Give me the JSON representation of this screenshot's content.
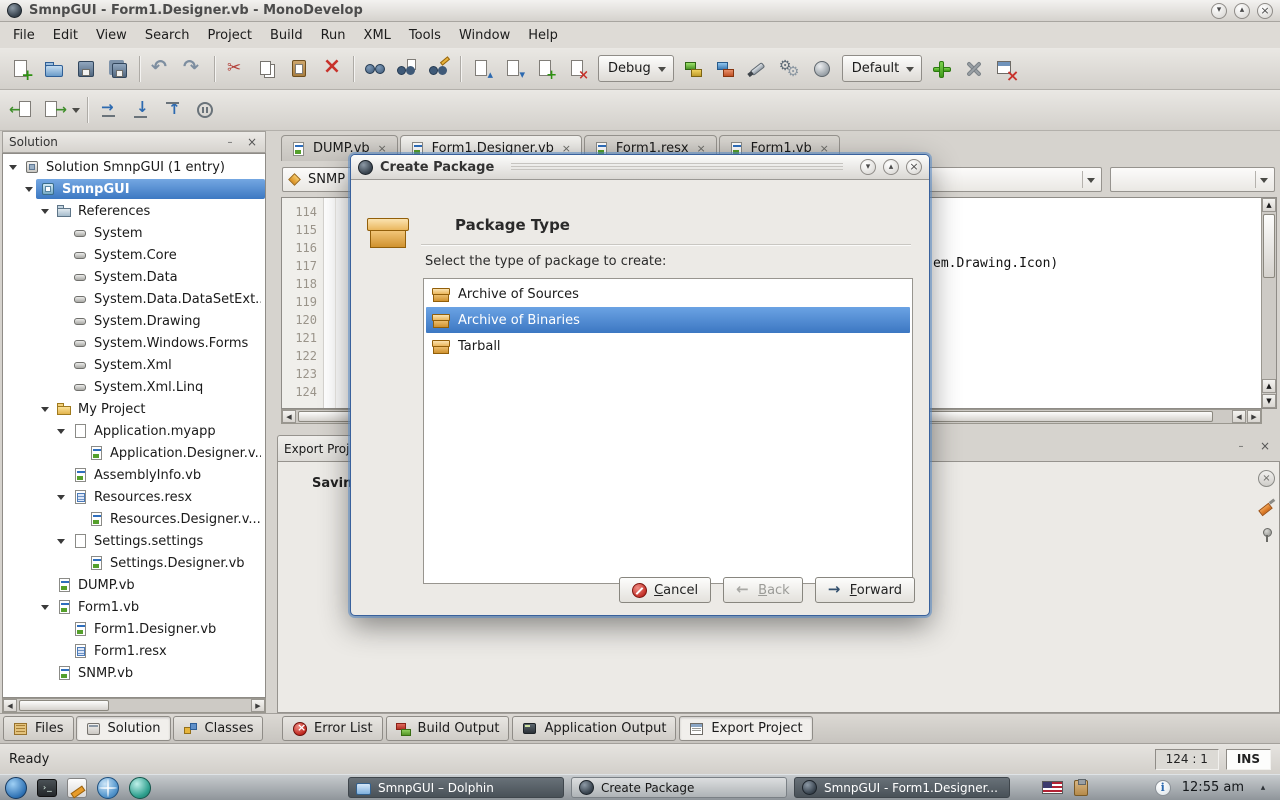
{
  "titlebar": {
    "title": "SmnpGUI - Form1.Designer.vb - MonoDevelop"
  },
  "menubar": {
    "items": [
      "File",
      "Edit",
      "View",
      "Search",
      "Project",
      "Build",
      "Run",
      "XML",
      "Tools",
      "Window",
      "Help"
    ]
  },
  "toolbar": {
    "debug_combo": "Debug",
    "default_combo": "Default"
  },
  "solution_panel": {
    "header": "Solution",
    "tree": [
      {
        "label": "Solution SmnpGUI (1 entry)",
        "level": 0,
        "icon": "solution",
        "expander": true
      },
      {
        "label": "SmnpGUI",
        "level": 1,
        "icon": "project",
        "expander": true,
        "selected": true
      },
      {
        "label": "References",
        "level": 2,
        "icon": "references-folder",
        "expander": true
      },
      {
        "label": "System",
        "level": 3,
        "icon": "reference"
      },
      {
        "label": "System.Core",
        "level": 3,
        "icon": "reference"
      },
      {
        "label": "System.Data",
        "level": 3,
        "icon": "reference"
      },
      {
        "label": "System.Data.DataSetExt...",
        "level": 3,
        "icon": "reference"
      },
      {
        "label": "System.Drawing",
        "level": 3,
        "icon": "reference"
      },
      {
        "label": "System.Windows.Forms",
        "level": 3,
        "icon": "reference"
      },
      {
        "label": "System.Xml",
        "level": 3,
        "icon": "reference"
      },
      {
        "label": "System.Xml.Linq",
        "level": 3,
        "icon": "reference"
      },
      {
        "label": "My Project",
        "level": 2,
        "icon": "folder",
        "expander": true
      },
      {
        "label": "Application.myapp",
        "level": 3,
        "icon": "page",
        "expander": true
      },
      {
        "label": "Application.Designer.v...",
        "level": 4,
        "icon": "vb"
      },
      {
        "label": "AssemblyInfo.vb",
        "level": 3,
        "icon": "vb"
      },
      {
        "label": "Resources.resx",
        "level": 3,
        "icon": "resx",
        "expander": true
      },
      {
        "label": "Resources.Designer.v...",
        "level": 4,
        "icon": "vb"
      },
      {
        "label": "Settings.settings",
        "level": 3,
        "icon": "page",
        "expander": true
      },
      {
        "label": "Settings.Designer.vb",
        "level": 4,
        "icon": "vb"
      },
      {
        "label": "DUMP.vb",
        "level": 2,
        "icon": "vb"
      },
      {
        "label": "Form1.vb",
        "level": 2,
        "icon": "vb",
        "expander": true
      },
      {
        "label": "Form1.Designer.vb",
        "level": 3,
        "icon": "vb"
      },
      {
        "label": "Form1.resx",
        "level": 3,
        "icon": "resx"
      },
      {
        "label": "SNMP.vb",
        "level": 2,
        "icon": "vb"
      }
    ],
    "tabs": [
      {
        "label": "Files",
        "icon": "files"
      },
      {
        "label": "Solution",
        "icon": "solution",
        "active": true
      },
      {
        "label": "Classes",
        "icon": "classes"
      }
    ]
  },
  "editor": {
    "tabs": [
      {
        "label": "DUMP.vb"
      },
      {
        "label": "Form1.Designer.vb",
        "active": true
      },
      {
        "label": "Form1.resx"
      },
      {
        "label": "Form1.vb"
      }
    ],
    "scope_combo": "SNMP",
    "member_combo": "",
    "region_combo": "",
    "line_numbers": [
      "114",
      "115",
      "116",
      "117",
      "118",
      "119",
      "120",
      "121",
      "122",
      "123",
      "124"
    ],
    "code_fragment": "em.Drawing.Icon)"
  },
  "output_panel": {
    "tab_label": "Export Projec",
    "message": "Saving p",
    "tabs": [
      {
        "label": "Error List",
        "icon": "error-list"
      },
      {
        "label": "Build Output",
        "icon": "build-output"
      },
      {
        "label": "Application Output",
        "icon": "application-output"
      },
      {
        "label": "Export Project",
        "icon": "export-project",
        "active": true
      }
    ]
  },
  "dialog": {
    "title": "Create Package",
    "heading": "Package Type",
    "prompt": "Select the type of package to create:",
    "options": [
      {
        "label": "Archive of Sources"
      },
      {
        "label": "Archive of Binaries",
        "selected": true
      },
      {
        "label": "Tarball"
      }
    ],
    "cancel_label": "Cancel",
    "back_label": "Back",
    "forward_label": "Forward"
  },
  "statusbar": {
    "status": "Ready",
    "caret": "124 : 1",
    "mode": "INS"
  },
  "taskbar": {
    "windows": [
      {
        "label": "SmnpGUI – Dolphin",
        "icon": "dolphin"
      },
      {
        "label": "Create Package",
        "icon": "monodevelop",
        "active": true
      },
      {
        "label": "SmnpGUI - Form1.Designer...",
        "icon": "monodevelop"
      }
    ],
    "clock": "12:55 am"
  },
  "colors": {
    "selection_blue": "#3c78c2",
    "dialog_border_blue": "#39619c",
    "package_orange": "#e8a33d"
  }
}
